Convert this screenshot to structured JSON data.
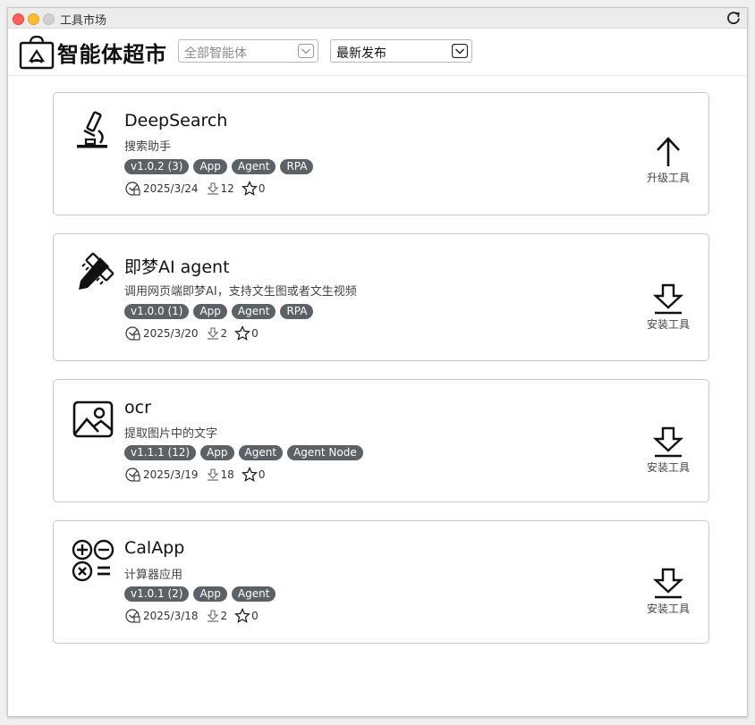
{
  "window": {
    "title": "工具市场"
  },
  "header": {
    "brand": "智能体超市",
    "filter_select": {
      "value": "全部智能体"
    },
    "sort_select": {
      "value": "最新发布"
    }
  },
  "cards": [
    {
      "name": "DeepSearch",
      "desc": "搜索助手",
      "icon": "microscope-icon",
      "tags": [
        "v1.0.2 (3)",
        "App",
        "Agent",
        "RPA"
      ],
      "date": "2025/3/24",
      "downloads": "12",
      "stars": "0",
      "action": "升级工具",
      "action_icon": "arrow-up-icon"
    },
    {
      "name": "即梦AI agent",
      "desc": "调用网页端即梦AI，支持文生图或者文生视频",
      "icon": "pencil-ruler-icon",
      "tags": [
        "v1.0.0 (1)",
        "App",
        "Agent",
        "RPA"
      ],
      "date": "2025/3/20",
      "downloads": "2",
      "stars": "0",
      "action": "安装工具",
      "action_icon": "download-icon"
    },
    {
      "name": "ocr",
      "desc": "提取图片中的文字",
      "icon": "image-icon",
      "tags": [
        "v1.1.1 (12)",
        "App",
        "Agent",
        "Agent Node"
      ],
      "date": "2025/3/19",
      "downloads": "18",
      "stars": "0",
      "action": "安装工具",
      "action_icon": "download-icon"
    },
    {
      "name": "CalApp",
      "desc": "计算器应用",
      "icon": "calculator-icon",
      "tags": [
        "v1.0.1 (2)",
        "App",
        "Agent"
      ],
      "date": "2025/3/18",
      "downloads": "2",
      "stars": "0",
      "action": "安装工具",
      "action_icon": "download-icon"
    }
  ]
}
